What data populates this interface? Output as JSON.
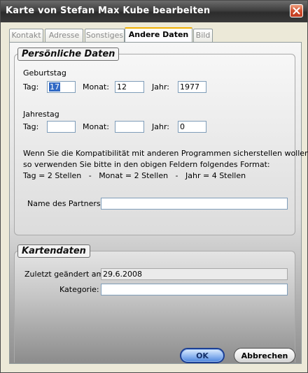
{
  "window": {
    "title": "Karte von Stefan Max Kube bearbeiten"
  },
  "tabs": [
    {
      "label": "Kontakt",
      "active": false
    },
    {
      "label": "Adresse",
      "active": false
    },
    {
      "label": "Sonstiges",
      "active": false
    },
    {
      "label": "Andere Daten",
      "active": true
    },
    {
      "label": "Bild",
      "active": false
    }
  ],
  "personal": {
    "legend": "Persönliche Daten",
    "birthday": {
      "heading": "Geburtstag",
      "day_label": "Tag:",
      "day_value": "17",
      "month_label": "Monat:",
      "month_value": "12",
      "year_label": "Jahr:",
      "year_value": "1977"
    },
    "anniversary": {
      "heading": "Jahrestag",
      "day_label": "Tag:",
      "day_value": "",
      "month_label": "Monat:",
      "month_value": "",
      "year_label": "Jahr:",
      "year_value": "0"
    },
    "info_line1": "Wenn Sie die Kompatibilität mit anderen Programmen sicherstellen wollen,",
    "info_line2": "so verwenden Sie bitte in den obigen Feldern folgendes Format:",
    "info_line3": "Tag = 2 Stellen   -   Monat = 2 Stellen   -   Jahr = 4 Stellen",
    "partner_label": "Name des Partners:",
    "partner_value": ""
  },
  "card": {
    "legend": "Kartendaten",
    "changed_label": "Zuletzt geändert am:",
    "changed_value": "29.6.2008",
    "category_label": "Kategorie:",
    "category_value": ""
  },
  "buttons": {
    "ok": "OK",
    "cancel": "Abbrechen"
  },
  "colors": {
    "titlebar": "#3e3e3e",
    "selection": "#316ac5",
    "ok_button": "#4c84db"
  }
}
